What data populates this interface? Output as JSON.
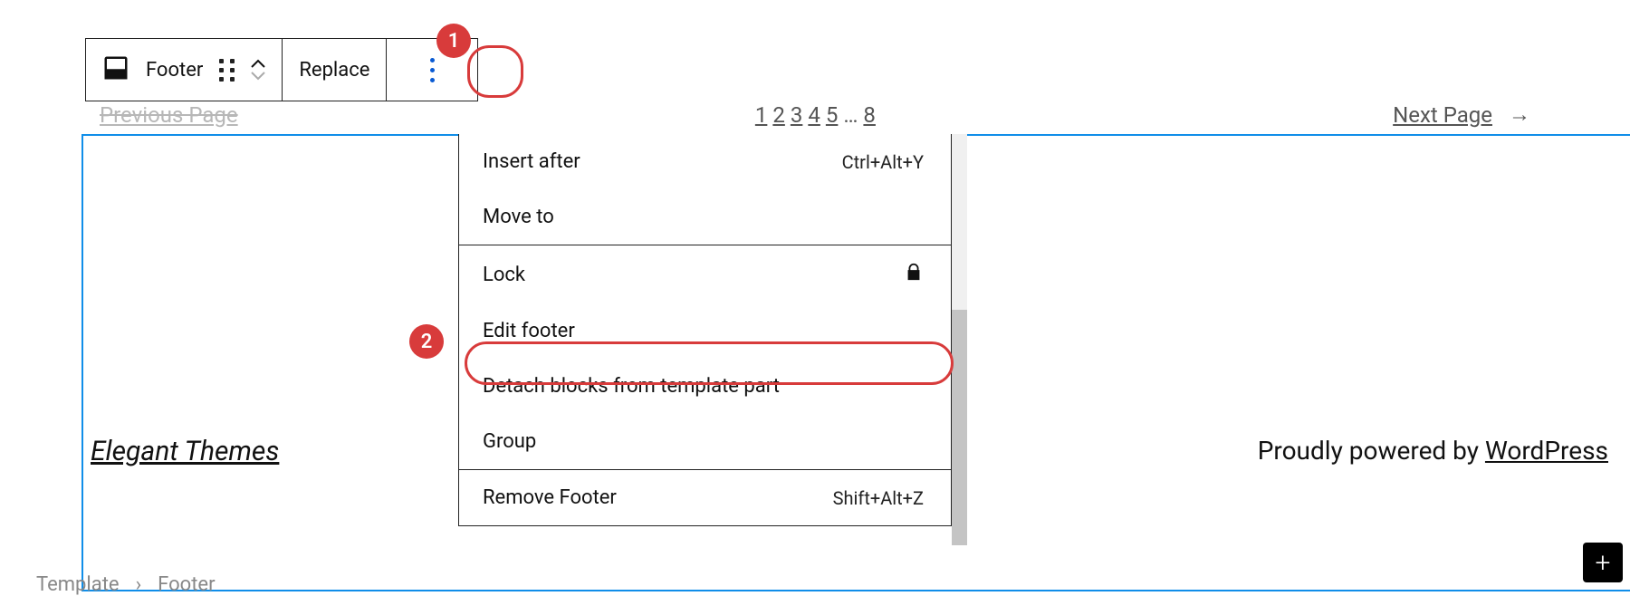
{
  "toolbar": {
    "block_label": "Footer",
    "replace_label": "Replace"
  },
  "callouts": {
    "one": "1",
    "two": "2"
  },
  "pagination": {
    "prev": "Previous Page",
    "pages": [
      "1",
      "2",
      "3",
      "4",
      "5",
      "…",
      "8"
    ],
    "next": "Next Page",
    "arrow": "→"
  },
  "footer": {
    "left_text": "Elegant Themes",
    "right_prefix": "Proudly powered by ",
    "right_link": "WordPress"
  },
  "menu": {
    "insert_after": "Insert after",
    "insert_after_shortcut": "Ctrl+Alt+Y",
    "move_to": "Move to",
    "lock": "Lock",
    "edit_footer": "Edit footer",
    "detach": "Detach blocks from template part",
    "group": "Group",
    "remove": "Remove Footer",
    "remove_shortcut": "Shift+Alt+Z"
  },
  "breadcrumb": {
    "template": "Template",
    "sep": "›",
    "footer": "Footer"
  }
}
